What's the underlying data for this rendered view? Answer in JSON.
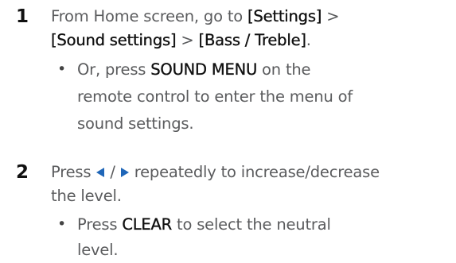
{
  "steps": [
    {
      "number": "1",
      "line1_prefix": "From Home screen, go to ",
      "menu1": "[Settings]",
      "sep1": " >",
      "menu2": "[Sound settings]",
      "sep2": " > ",
      "menu3": "[Bass / Treble]",
      "line2_suffix": ".",
      "bullet": {
        "symbol": "•",
        "prefix": "Or, press ",
        "key": "SOUND MENU",
        "line1_suffix": " on the",
        "line2": "remote control to enter the menu of",
        "line3": "sound settings."
      }
    },
    {
      "number": "2",
      "prefix": "Press ",
      "left_icon": "left-arrow-icon",
      "slash": " / ",
      "right_icon": "right-arrow-icon",
      "line1_suffix": " repeatedly to increase/decrease",
      "line2": "the level.",
      "bullet": {
        "symbol": "•",
        "prefix": "Press ",
        "key": "CLEAR",
        "line1_suffix": " to select the neutral",
        "line2": "level."
      }
    }
  ],
  "colors": {
    "text": "#5a5b5d",
    "emphasis": "#111111",
    "arrow": "#1f66b8"
  }
}
